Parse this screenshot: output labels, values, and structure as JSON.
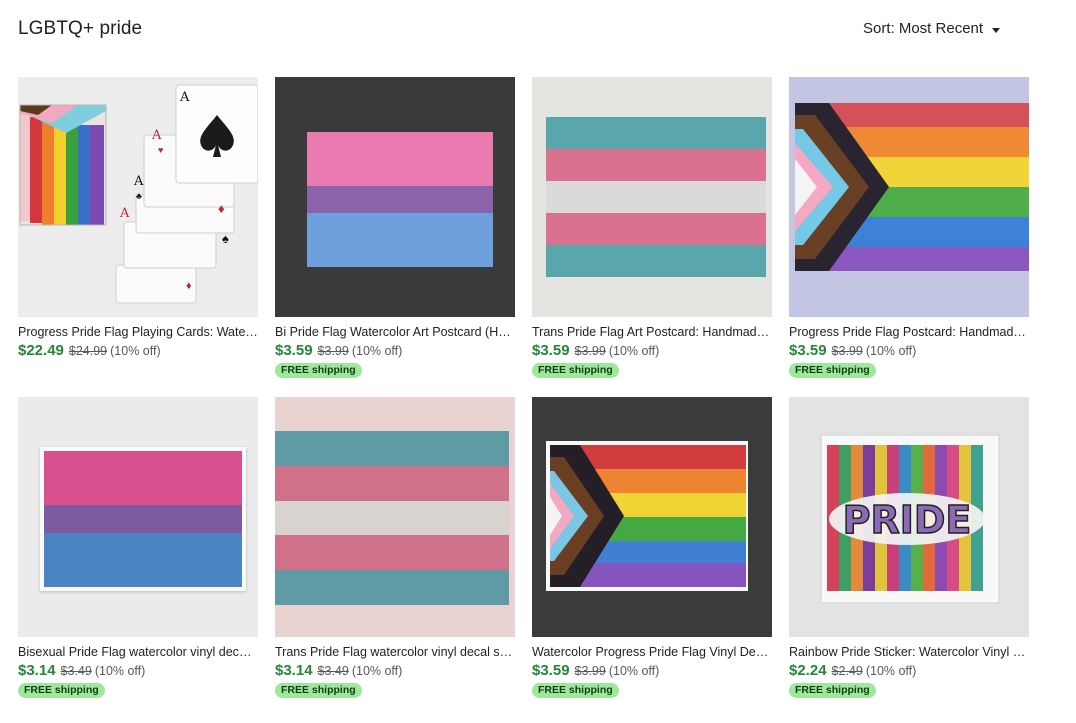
{
  "page": {
    "title": "LGBTQ+ pride",
    "sort_label": "Sort: Most Recent"
  },
  "listings": [
    {
      "name": "Progress Pride Flag Playing Cards: Watercolor Art",
      "price": "$22.49",
      "original": "$24.99",
      "discount": "(10% off)",
      "free_shipping": ""
    },
    {
      "name": "Bi Pride Flag Watercolor Art Postcard (Handmade)",
      "price": "$3.59",
      "original": "$3.99",
      "discount": "(10% off)",
      "free_shipping": "FREE shipping"
    },
    {
      "name": "Trans Pride Flag Art Postcard: Handmade Watercolor",
      "price": "$3.59",
      "original": "$3.99",
      "discount": "(10% off)",
      "free_shipping": "FREE shipping"
    },
    {
      "name": "Progress Pride Flag Postcard: Handmade Watercolor",
      "price": "$3.59",
      "original": "$3.99",
      "discount": "(10% off)",
      "free_shipping": "FREE shipping"
    },
    {
      "name": "Bisexual Pride Flag watercolor vinyl decal sticker",
      "price": "$3.14",
      "original": "$3.49",
      "discount": "(10% off)",
      "free_shipping": "FREE shipping"
    },
    {
      "name": "Trans Pride Flag watercolor vinyl decal sticker",
      "price": "$3.14",
      "original": "$3.49",
      "discount": "(10% off)",
      "free_shipping": "FREE shipping"
    },
    {
      "name": "Watercolor Progress Pride Flag Vinyl Decal Sticker",
      "price": "$3.59",
      "original": "$3.99",
      "discount": "(10% off)",
      "free_shipping": "FREE shipping"
    },
    {
      "name": "Rainbow Pride Sticker: Watercolor Vinyl Decal",
      "price": "$2.24",
      "original": "$2.49",
      "discount": "(10% off)",
      "free_shipping": "FREE shipping"
    }
  ],
  "art": {
    "card_ranks": [
      "A",
      "A",
      "A",
      "A"
    ],
    "sticker_word": "PRIDE"
  },
  "colors": {
    "price_green": "#258635",
    "badge_bg": "#9ee89c",
    "rainbow": [
      "#d4373a",
      "#ee7f2d",
      "#f2d12f",
      "#3a9f3e",
      "#3a6fc9",
      "#7a4bb0"
    ],
    "trans": [
      "#4fa6b4",
      "#d66f8e",
      "#d8d8d8"
    ],
    "bi": [
      "#e0619a",
      "#8a5fa8",
      "#5b8fd0"
    ]
  }
}
